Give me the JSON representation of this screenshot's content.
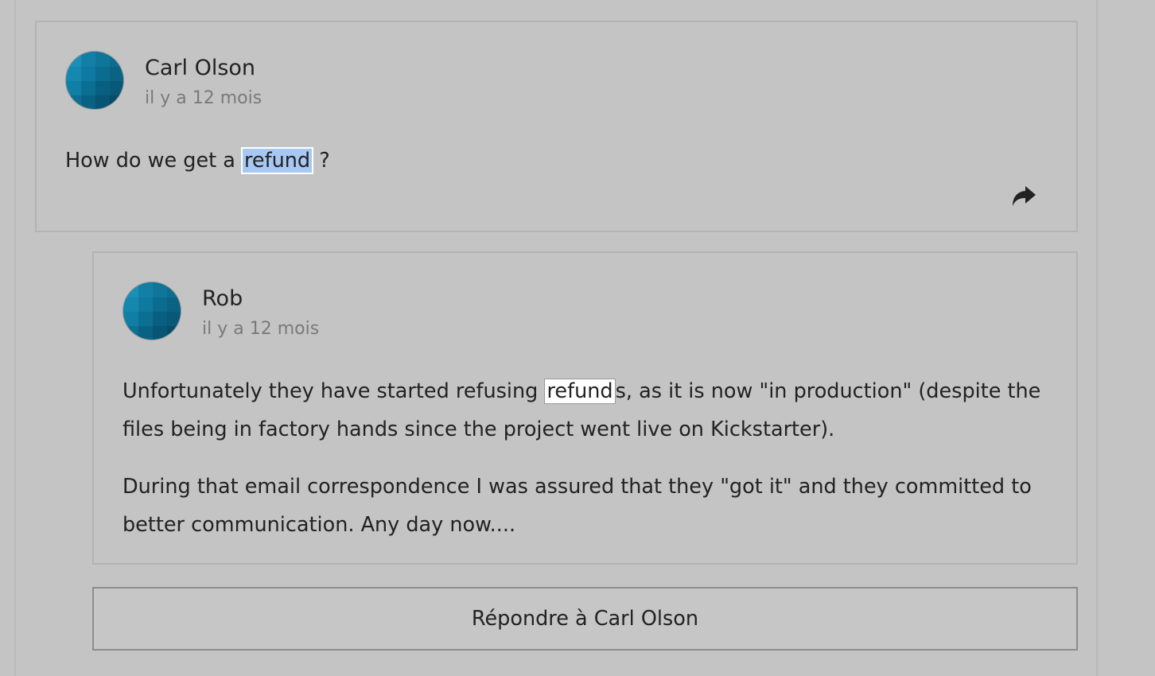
{
  "comments": [
    {
      "author": "Carl Olson",
      "time": "il y a 12 mois",
      "text_before": "How do we get a ",
      "highlight": "refund",
      "text_after": " ?",
      "avatar_icon": "avatar-tile-icon",
      "share_icon": "share-arrow-icon"
    },
    {
      "author": "Rob",
      "time": "il y a 12 mois",
      "p1_before": "Unfortunately they have started refusing ",
      "p1_highlight": "refund",
      "p1_after": "s, as it is now \"in production\" (despite the files being in factory hands since the project went live on Kickstarter).",
      "p2": "During that email correspondence I was assured that they \"got it\" and they committed to better communication. Any day now....",
      "avatar_icon": "avatar-tile-icon"
    }
  ],
  "reply_button_label": "Répondre à Carl Olson",
  "colors": {
    "background": "#c4c4c4",
    "avatar_base": "#0a6f92",
    "selection": "#a8c8f4",
    "muted_text": "#7a7a7a"
  }
}
